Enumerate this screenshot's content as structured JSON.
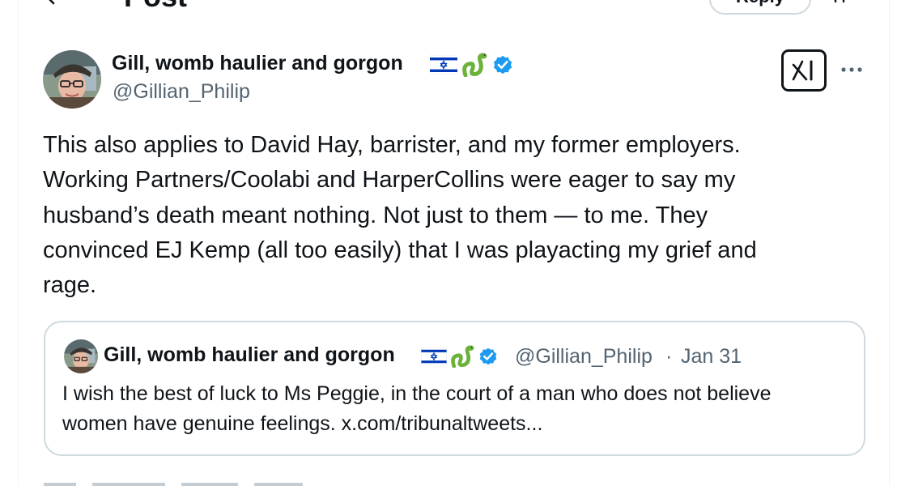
{
  "header": {
    "title": "Post",
    "reply_label": "Reply"
  },
  "post": {
    "author_name": "Gill, womb haulier and gorgon",
    "author_handle": "@Gillian_Philip",
    "badges": [
      "israel-flag-icon",
      "snake-icon",
      "verified-icon"
    ],
    "text_lines": [
      "This also applies to David Hay, barrister, and my former employers.",
      "Working Partners/Coolabi and HarperCollins were eager to say my",
      "husband’s death meant nothing. Not just to them — to me. They",
      "convinced EJ Kemp (all too easily) that I was playacting my grief and",
      "rage."
    ]
  },
  "quoted": {
    "author_name": "Gill, womb haulier and gorgon",
    "author_handle": "@Gillian_Philip",
    "separator": "·",
    "date": "Jan 31",
    "text_lines": [
      "I wish the best of luck to Ms Peggie, in the court of a man who does not believe",
      "women have genuine feelings. x.com/tribunaltweets..."
    ]
  },
  "colors": {
    "text": "#0f1419",
    "secondary": "#536471",
    "border": "#cfd9de",
    "verified": "#1d9bf0",
    "flag_blue": "#0038b8"
  }
}
